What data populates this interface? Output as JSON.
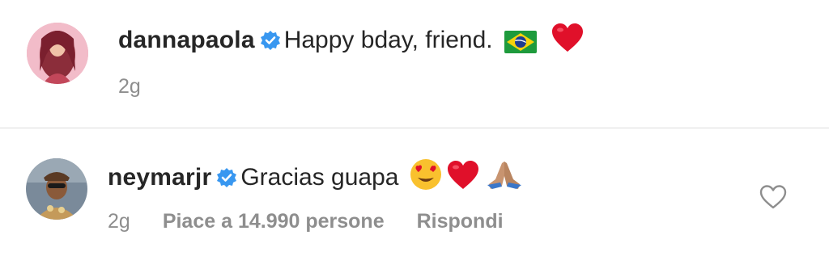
{
  "comments": [
    {
      "username": "dannapaola",
      "text": "Happy bday, friend.",
      "emojis": [
        "brazil-flag",
        "red-heart"
      ],
      "time": "2g",
      "likes": "",
      "reply_label": ""
    },
    {
      "username": "neymarjr",
      "text": "Gracias guapa",
      "emojis": [
        "heart-eyes",
        "red-heart",
        "folded-hands"
      ],
      "time": "2g",
      "likes": "Piace a 14.990 persone",
      "reply_label": "Rispondi"
    }
  ],
  "colors": {
    "verified_blue": "#3897f0",
    "secondary_text": "#8e8e8e",
    "divider": "#dbdbdb",
    "heart_red": "#e0102a"
  }
}
